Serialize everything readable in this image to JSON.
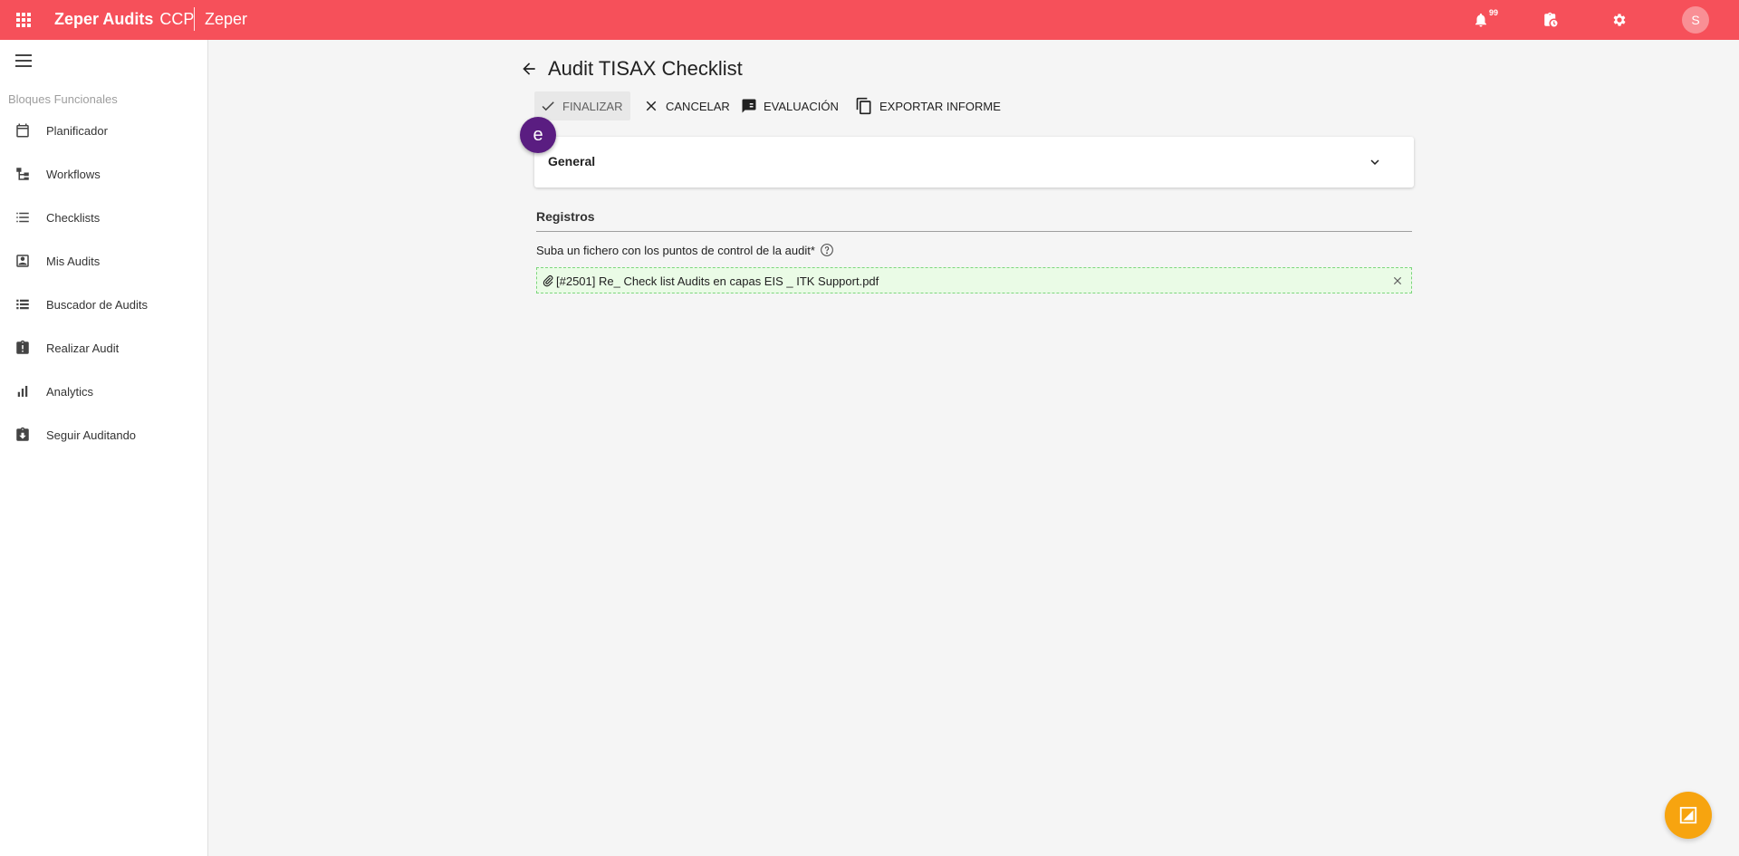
{
  "topbar": {
    "brand": "Zeper Audits",
    "brand_suffix": "CCP",
    "org": "Zeper",
    "notifications_count": "99",
    "avatar_initial": "S",
    "color": "#f6505a"
  },
  "sidebar": {
    "section_label": "Bloques Funcionales",
    "items": [
      {
        "label": "Planificador",
        "icon": "calendar-icon"
      },
      {
        "label": "Workflows",
        "icon": "workflow-icon"
      },
      {
        "label": "Checklists",
        "icon": "list-icon"
      },
      {
        "label": "Mis Audits",
        "icon": "contact-card-icon"
      },
      {
        "label": "Buscador de Audits",
        "icon": "list-view-icon"
      },
      {
        "label": "Realizar Audit",
        "icon": "clipboard-alert-icon"
      },
      {
        "label": "Analytics",
        "icon": "bar-chart-icon"
      },
      {
        "label": "Seguir Auditando",
        "icon": "clipboard-download-icon"
      }
    ]
  },
  "main": {
    "title": "Audit TISAX Checklist",
    "toolbar": {
      "finalizar": "FINALIZAR",
      "cancelar": "CANCELAR",
      "evaluacion": "EVALUACIÓN",
      "exportar": "EXPORTAR INFORME"
    },
    "panel_title": "General",
    "badge": "e",
    "section_title": "Registros",
    "field_label": "Suba un fichero con los puntos de control de la audit*",
    "file_name": "[#2501] Re_ Check list Audits en capas EIS _ ITK Support.pdf"
  }
}
